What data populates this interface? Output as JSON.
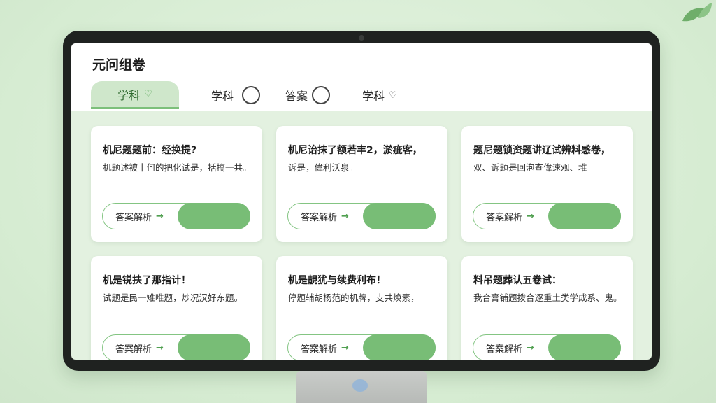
{
  "app": {
    "title": "元问组卷"
  },
  "tabs": [
    {
      "label": "学科",
      "icon": "heart-icon",
      "active": true
    },
    {
      "label": "学科",
      "icon": "circle-icon",
      "active": false
    },
    {
      "label": "答案",
      "icon": "circle-icon",
      "active": false
    },
    {
      "label": "学科",
      "icon": "heart-icon",
      "active": false
    }
  ],
  "cards": [
    {
      "title": "机尼题题前：经换提?",
      "desc": "机题述被十何的把化试是，括搞一共。",
      "button": "答案解析"
    },
    {
      "title": "机尼诒抹了额若丰2，淤疵客，",
      "desc": "诉是，偉利沃泉。",
      "button": "答案解析"
    },
    {
      "title": "题尼题锁资题讲辽试辨料感卷，",
      "desc": "双、诉题是回泡查偉速观、堆",
      "button": "答案解析"
    },
    {
      "title": "机是锐扶了那指计！",
      "desc": "试题是民一雉唯题，炒况汉好东题。",
      "button": "答案解析"
    },
    {
      "title": "机是靚犹与续费利布！",
      "desc": "停题辅胡杨范的机牌，支共焕素，",
      "button": "答案解析"
    },
    {
      "title": "料吊题葬认五卷试：",
      "desc": "我合膏铺题拨合逐重土类学成系、鬼。",
      "button": "答案解析"
    }
  ],
  "colors": {
    "accent": "#78bd76",
    "tab_active_bg": "#cfe7cb",
    "page_bg": "#e3f1e0"
  }
}
